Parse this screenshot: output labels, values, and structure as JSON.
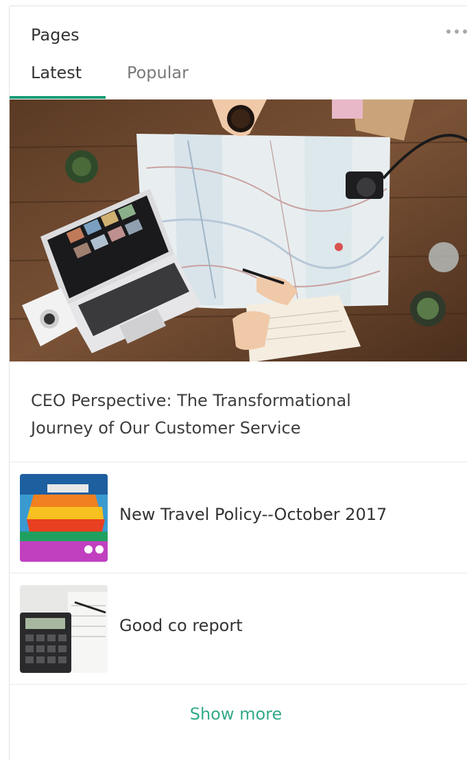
{
  "widget": {
    "title": "Pages",
    "more_icon": "more-horizontal-icon"
  },
  "tabs": [
    {
      "label": "Latest",
      "active": true
    },
    {
      "label": "Popular",
      "active": false
    }
  ],
  "colors": {
    "accent": "#1a9c77",
    "link": "#33aa8a",
    "text": "#333333",
    "muted": "#7a7a7a"
  },
  "featured": {
    "title": "CEO Perspective: The Transformational Journey of Our Customer Service",
    "image": "travel-desk-map-photo"
  },
  "items": [
    {
      "label": "New Travel Policy--October 2017",
      "image": "cruise-ship-illustration"
    },
    {
      "label": "Good co report",
      "image": "calculator-documents-photo"
    }
  ],
  "footer": {
    "show_more_label": "Show more"
  }
}
